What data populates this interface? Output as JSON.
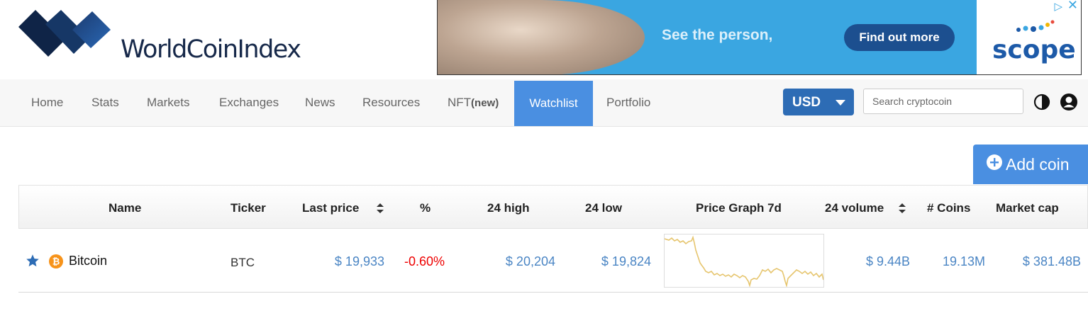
{
  "brand": {
    "name": "WorldCoinIndex"
  },
  "ad": {
    "headline": "See the person,",
    "cta": "Find out more",
    "brand": "scope",
    "info_icon": "adchoices-icon",
    "close_icon": "close-icon"
  },
  "nav": {
    "items": [
      {
        "label": "Home"
      },
      {
        "label": "Stats"
      },
      {
        "label": "Markets"
      },
      {
        "label": "Exchanges"
      },
      {
        "label": "News"
      },
      {
        "label": "Resources"
      },
      {
        "label": "NFT",
        "badge": "(new)"
      },
      {
        "label": "Watchlist",
        "active": true
      },
      {
        "label": "Portfolio"
      }
    ],
    "currency": "USD",
    "search_placeholder": "Search cryptocoin"
  },
  "actions": {
    "add_coin": "Add coin"
  },
  "table": {
    "headers": {
      "name": "Name",
      "ticker": "Ticker",
      "last_price": "Last price",
      "percent": "%",
      "high": "24 high",
      "low": "24 low",
      "graph": "Price Graph 7d",
      "volume": "24 volume",
      "coins": "# Coins",
      "market_cap": "Market cap"
    },
    "rows": [
      {
        "name": "Bitcoin",
        "ticker": "BTC",
        "last_price": "$ 19,933",
        "percent": "-0.60%",
        "high": "$ 20,204",
        "low": "$ 19,824",
        "volume": "$ 9.44B",
        "coins": "19.13M",
        "market_cap": "$ 381.48B"
      }
    ]
  },
  "colors": {
    "accent": "#4a8fe1",
    "currency_bg": "#2d6cb5",
    "price_blue": "#4a85c4",
    "negative": "#ee0000",
    "graph_line": "#e6c56e"
  }
}
